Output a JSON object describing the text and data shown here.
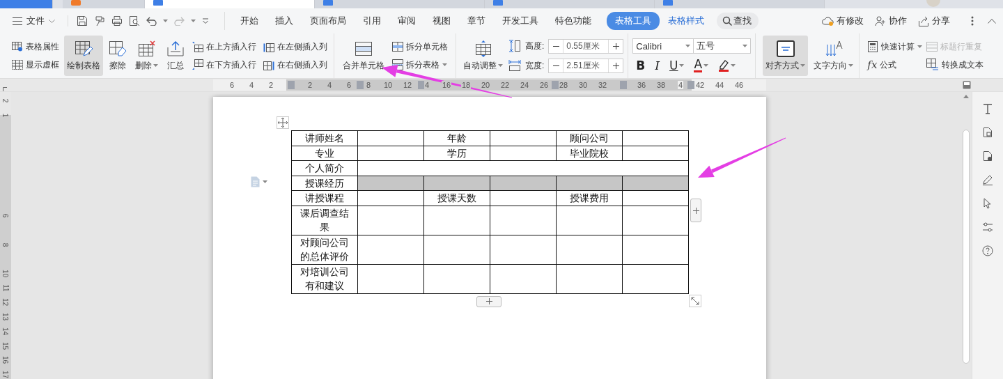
{
  "document_tabs": [
    {
      "kind": "home",
      "selected": false
    },
    {
      "kind": "app",
      "selected": false
    },
    {
      "kind": "doc",
      "selected": true
    },
    {
      "kind": "doc",
      "selected": false
    },
    {
      "kind": "doc",
      "selected": false
    },
    {
      "kind": "doc",
      "selected": false
    }
  ],
  "menu_bar": {
    "file_menu": "文件",
    "tabs": [
      {
        "label": "开始",
        "kind": "main",
        "selected": false
      },
      {
        "label": "插入",
        "kind": "main",
        "selected": false
      },
      {
        "label": "页面布局",
        "kind": "main",
        "selected": false
      },
      {
        "label": "引用",
        "kind": "main",
        "selected": false
      },
      {
        "label": "审阅",
        "kind": "main",
        "selected": false
      },
      {
        "label": "视图",
        "kind": "main",
        "selected": false
      },
      {
        "label": "章节",
        "kind": "main",
        "selected": false
      },
      {
        "label": "开发工具",
        "kind": "main",
        "selected": false
      },
      {
        "label": "特色功能",
        "kind": "main",
        "selected": false
      },
      {
        "label": "表格工具",
        "kind": "context",
        "selected": true
      },
      {
        "label": "表格样式",
        "kind": "context",
        "selected": false
      }
    ],
    "search": "查找",
    "actions": [
      {
        "kind": "changes",
        "label": "有修改"
      },
      {
        "kind": "collaborate",
        "label": "协作"
      },
      {
        "kind": "share",
        "label": "分享"
      }
    ]
  },
  "ribbon": {
    "table_options": [
      "表格属性",
      "显示虚框"
    ],
    "tools": [
      {
        "kind": "draw",
        "label": "绘制表格",
        "pressed": true,
        "dropdown": false
      },
      {
        "kind": "erase",
        "label": "擦除",
        "pressed": false,
        "dropdown": false
      },
      {
        "kind": "delete",
        "label": "删除",
        "pressed": false,
        "dropdown": true
      },
      {
        "kind": "sum",
        "label": "汇总",
        "pressed": false,
        "dropdown": false
      }
    ],
    "insert": [
      "在上方插入行",
      "在下方插入行",
      "在左侧插入列",
      "在右侧插入列"
    ],
    "merge": "合并单元格",
    "split": [
      {
        "label": "拆分单元格",
        "dropdown": false
      },
      {
        "label": "拆分表格",
        "dropdown": true
      }
    ],
    "auto_fit": "自动调整",
    "size_fields": [
      {
        "kind": "height",
        "label": "高度:",
        "value": "0.55厘米"
      },
      {
        "kind": "width",
        "label": "宽度:",
        "value": "2.51厘米"
      }
    ],
    "font": {
      "name": "Calibri",
      "size": "五号"
    },
    "format_buttons": [
      {
        "kind": "bold",
        "glyph": "B",
        "dropdown": false
      },
      {
        "kind": "italic",
        "glyph": "I",
        "dropdown": false
      },
      {
        "kind": "underline",
        "glyph": "U",
        "dropdown": true
      },
      {
        "kind": "font-color",
        "glyph": "A",
        "dropdown": true
      },
      {
        "kind": "highlight",
        "dropdown": true
      }
    ],
    "alignment": {
      "label": "对齐方式",
      "pressed": true
    },
    "text_direction": "文字方向",
    "calc": [
      {
        "kind": "quick-calc",
        "label": "快速计算",
        "dropdown": true,
        "disabled": false
      },
      {
        "kind": "repeat-header",
        "label": "标题行重复",
        "dropdown": false,
        "disabled": true
      },
      {
        "kind": "formula",
        "glyph": "fx",
        "label": "公式",
        "dropdown": false,
        "disabled": false
      },
      {
        "kind": "to-text",
        "label": "转换成文本",
        "dropdown": false,
        "disabled": false
      }
    ]
  },
  "ruler": {
    "labels": [
      {
        "kind": "number",
        "text": "6"
      },
      {
        "kind": "number",
        "text": "4"
      },
      {
        "kind": "number",
        "text": "2"
      },
      {
        "kind": "blank"
      },
      {
        "kind": "number",
        "text": "2"
      },
      {
        "kind": "number",
        "text": "4"
      },
      {
        "kind": "number",
        "text": "6"
      },
      {
        "kind": "number",
        "text": "8"
      },
      {
        "kind": "number",
        "text": "10"
      },
      {
        "kind": "number",
        "text": "12"
      },
      {
        "kind": "number",
        "text": "4"
      },
      {
        "kind": "number",
        "text": "16"
      },
      {
        "kind": "number",
        "text": "18"
      },
      {
        "kind": "number",
        "text": "20"
      },
      {
        "kind": "number",
        "text": "22"
      },
      {
        "kind": "number",
        "text": "24"
      },
      {
        "kind": "number",
        "text": "26"
      },
      {
        "kind": "number",
        "text": "28"
      },
      {
        "kind": "number",
        "text": "30"
      },
      {
        "kind": "number",
        "text": "32"
      },
      {
        "kind": "blank"
      },
      {
        "kind": "number",
        "text": "36"
      },
      {
        "kind": "number",
        "text": "38"
      },
      {
        "kind": "number",
        "text": "4"
      },
      {
        "kind": "number",
        "text": "42"
      },
      {
        "kind": "number",
        "text": "44"
      },
      {
        "kind": "number",
        "text": "46"
      }
    ]
  },
  "vertical_ruler": {
    "labels": [
      {
        "kind": "number",
        "text": "2"
      },
      {
        "kind": "number",
        "text": "1"
      },
      {
        "kind": "blank"
      },
      {
        "kind": "blank"
      },
      {
        "kind": "blank"
      },
      {
        "kind": "blank"
      },
      {
        "kind": "blank"
      },
      {
        "kind": "blank"
      },
      {
        "kind": "number",
        "text": "6"
      },
      {
        "kind": "blank"
      },
      {
        "kind": "number",
        "text": "8"
      },
      {
        "kind": "blank"
      },
      {
        "kind": "number",
        "text": "10"
      },
      {
        "kind": "number",
        "text": "11"
      },
      {
        "kind": "number",
        "text": "12"
      },
      {
        "kind": "number",
        "text": "13"
      },
      {
        "kind": "number",
        "text": "14"
      },
      {
        "kind": "number",
        "text": "15"
      },
      {
        "kind": "number",
        "text": "16"
      },
      {
        "kind": "number",
        "text": "17"
      }
    ]
  },
  "table": {
    "rows": [
      {
        "kind": "grid",
        "shaded": false,
        "cells": [
          "讲师姓名",
          null,
          "年龄",
          null,
          "顾问公司",
          null
        ]
      },
      {
        "kind": "grid",
        "shaded": false,
        "cells": [
          "专业",
          null,
          "学历",
          null,
          "毕业院校",
          null
        ]
      },
      {
        "kind": "wide",
        "shaded": false,
        "cells": [
          "个人简介",
          null
        ]
      },
      {
        "kind": "grid",
        "shaded": true,
        "cells": [
          "授课经历",
          null,
          null,
          null,
          null,
          null
        ]
      },
      {
        "kind": "grid",
        "shaded": false,
        "cells": [
          "讲授课程",
          null,
          "授课天数",
          null,
          "授课费用",
          null
        ]
      },
      {
        "kind": "grid",
        "shaded": false,
        "cells": [
          "课后调查结果",
          null,
          null,
          null,
          null,
          null
        ]
      },
      {
        "kind": "grid",
        "shaded": false,
        "cells": [
          "对顾问公司的总体评价",
          null,
          null,
          null,
          null,
          null
        ]
      },
      {
        "kind": "grid",
        "shaded": false,
        "cells": [
          "对培训公司有和建议",
          null,
          null,
          null,
          null,
          null
        ]
      }
    ]
  }
}
